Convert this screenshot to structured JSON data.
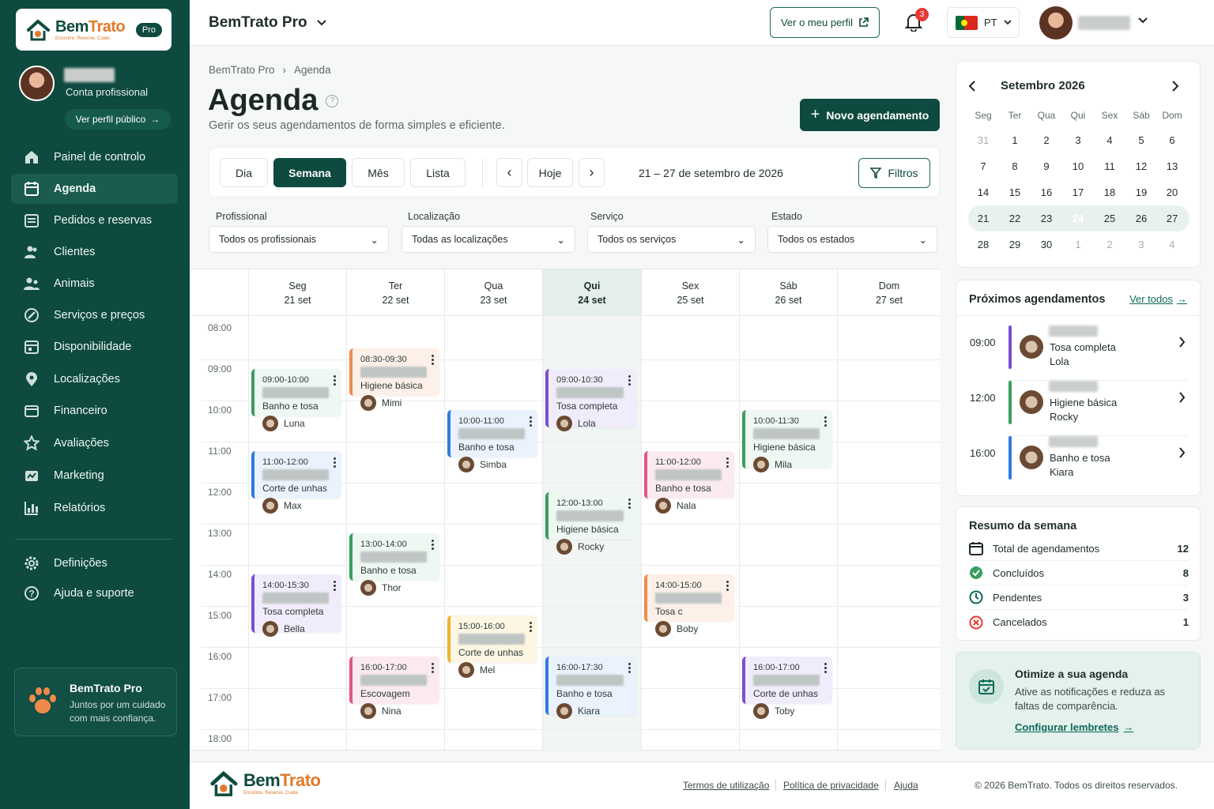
{
  "brand": {
    "name": "BemTrato",
    "tagline": "Encontre. Reserve. Cuide.",
    "badge": "Pro"
  },
  "colors": {
    "primary": "#0e4a3f",
    "accent": "#e07a2a",
    "today_bg": "#e4efec"
  },
  "sidebar": {
    "account_type": "Conta profissional",
    "public_profile_label": "Ver perfil público",
    "items": [
      {
        "label": "Painel de controlo",
        "icon": "home-icon"
      },
      {
        "label": "Agenda",
        "icon": "calendar-icon",
        "active": true
      },
      {
        "label": "Pedidos e reservas",
        "icon": "orders-icon"
      },
      {
        "label": "Clientes",
        "icon": "users-icon"
      },
      {
        "label": "Animais",
        "icon": "animals-icon"
      },
      {
        "label": "Serviços e preços",
        "icon": "tag-icon"
      },
      {
        "label": "Disponibilidade",
        "icon": "availability-icon"
      },
      {
        "label": "Localizações",
        "icon": "location-icon"
      },
      {
        "label": "Financeiro",
        "icon": "wallet-icon"
      },
      {
        "label": "Avaliações",
        "icon": "star-icon"
      },
      {
        "label": "Marketing",
        "icon": "marketing-icon"
      },
      {
        "label": "Relatórios",
        "icon": "chart-icon"
      }
    ],
    "bottom_items": [
      {
        "label": "Definições",
        "icon": "gear-icon"
      },
      {
        "label": "Ajuda e suporte",
        "icon": "help-icon"
      }
    ],
    "promo": {
      "title": "BemTrato Pro",
      "text": "Juntos por um cuidado com mais confiança."
    }
  },
  "header": {
    "app_title": "BemTrato Pro",
    "profile_button": "Ver o meu perfil",
    "notifications_count": "3",
    "language": "PT"
  },
  "breadcrumb": [
    "BemTrato Pro",
    "Agenda"
  ],
  "page": {
    "title": "Agenda",
    "subtitle": "Gerir os seus agendamentos de forma simples e eficiente.",
    "new_button": "Novo agendamento"
  },
  "toolbar": {
    "views": [
      "Dia",
      "Semana",
      "Mês",
      "Lista"
    ],
    "active_view": "Semana",
    "today_label": "Hoje",
    "range": "21 – 27 de setembro de 2026",
    "filters_label": "Filtros"
  },
  "filters": [
    {
      "label": "Profissional",
      "value": "Todos os profissionais"
    },
    {
      "label": "Localização",
      "value": "Todas as localizações"
    },
    {
      "label": "Serviço",
      "value": "Todos os serviços"
    },
    {
      "label": "Estado",
      "value": "Todos os estados"
    }
  ],
  "calendar": {
    "days": [
      {
        "name": "Seg",
        "date": "21 set"
      },
      {
        "name": "Ter",
        "date": "22 set"
      },
      {
        "name": "Qua",
        "date": "23 set"
      },
      {
        "name": "Qui",
        "date": "24 set",
        "today": true
      },
      {
        "name": "Sex",
        "date": "25 set"
      },
      {
        "name": "Sáb",
        "date": "26 set"
      },
      {
        "name": "Dom",
        "date": "27 set"
      }
    ],
    "hours": [
      "08:00",
      "09:00",
      "10:00",
      "11:00",
      "12:00",
      "13:00",
      "14:00",
      "15:00",
      "16:00",
      "17:00",
      "18:00"
    ],
    "events": [
      {
        "day": 0,
        "time": "09:00-10:00",
        "service": "Banho e tosa",
        "pet": "Luna",
        "color": "green"
      },
      {
        "day": 0,
        "time": "11:00-12:00",
        "service": "Corte de unhas",
        "pet": "Max",
        "color": "blue"
      },
      {
        "day": 0,
        "time": "14:00-15:30",
        "service": "Tosa completa",
        "pet": "Bella",
        "color": "purple"
      },
      {
        "day": 1,
        "time": "08:30-09:30",
        "service": "Higiene básica",
        "pet": "Mimi",
        "color": "orange"
      },
      {
        "day": 1,
        "time": "13:00-14:00",
        "service": "Banho e tosa",
        "pet": "Thor",
        "color": "green"
      },
      {
        "day": 1,
        "time": "16:00-17:00",
        "service": "Escovagem",
        "pet": "Nina",
        "color": "pink"
      },
      {
        "day": 2,
        "time": "10:00-11:00",
        "service": "Banho e tosa",
        "pet": "Simba",
        "color": "blue"
      },
      {
        "day": 2,
        "time": "15:00-16:00",
        "service": "Corte de unhas",
        "pet": "Mel",
        "color": "yellow"
      },
      {
        "day": 3,
        "time": "09:00-10:30",
        "service": "Tosa completa",
        "pet": "Lola",
        "color": "purple"
      },
      {
        "day": 3,
        "time": "12:00-13:00",
        "service": "Higiene básica",
        "pet": "Rocky",
        "color": "green"
      },
      {
        "day": 3,
        "time": "16:00-17:30",
        "service": "Banho e tosa",
        "pet": "Kiara",
        "color": "blue"
      },
      {
        "day": 4,
        "time": "11:00-12:00",
        "service": "Banho e tosa",
        "pet": "Nala",
        "color": "pink"
      },
      {
        "day": 4,
        "time": "14:00-15:00",
        "service": "Tosa c",
        "pet": "Boby",
        "color": "orange"
      },
      {
        "day": 5,
        "time": "10:00-11:30",
        "service": "Higiene básica",
        "pet": "Mila",
        "color": "green"
      },
      {
        "day": 5,
        "time": "16:00-17:00",
        "service": "Corte de unhas",
        "pet": "Toby",
        "color": "purple"
      }
    ]
  },
  "mini_calendar": {
    "title": "Setembro 2026",
    "weekdays": [
      "Seg",
      "Ter",
      "Qua",
      "Qui",
      "Sex",
      "Sáb",
      "Dom"
    ],
    "weeks": [
      [
        "31",
        "1",
        "2",
        "3",
        "4",
        "5",
        "6"
      ],
      [
        "7",
        "8",
        "9",
        "10",
        "11",
        "12",
        "13"
      ],
      [
        "14",
        "15",
        "16",
        "17",
        "18",
        "19",
        "20"
      ],
      [
        "21",
        "22",
        "23",
        "24",
        "25",
        "26",
        "27"
      ],
      [
        "28",
        "29",
        "30",
        "1",
        "2",
        "3",
        "4"
      ]
    ],
    "selected": "24"
  },
  "upcoming": {
    "title": "Próximos agendamentos",
    "see_all": "Ver todos",
    "items": [
      {
        "time": "09:00",
        "service": "Tosa completa",
        "pet": "Lola",
        "color": "#7a4fd0"
      },
      {
        "time": "12:00",
        "service": "Higiene básica",
        "pet": "Rocky",
        "color": "#3a9e5e"
      },
      {
        "time": "16:00",
        "service": "Banho e tosa",
        "pet": "Kiara",
        "color": "#2f7be0"
      }
    ]
  },
  "summary": {
    "title": "Resumo da semana",
    "rows": [
      {
        "label": "Total de agendamentos",
        "value": "12",
        "icon": "calendar-icon"
      },
      {
        "label": "Concluídos",
        "value": "8",
        "icon": "check-circle-icon"
      },
      {
        "label": "Pendentes",
        "value": "3",
        "icon": "clock-icon"
      },
      {
        "label": "Cancelados",
        "value": "1",
        "icon": "x-circle-icon"
      }
    ]
  },
  "tip": {
    "title": "Otimize a sua agenda",
    "text": "Ative as notificações e reduza as faltas de comparência.",
    "link": "Configurar lembretes"
  },
  "footer": {
    "links": [
      "Termos de utilização",
      "Política de privacidade",
      "Ajuda"
    ],
    "copyright": "© 2026 BemTrato. Todos os direitos reservados."
  }
}
